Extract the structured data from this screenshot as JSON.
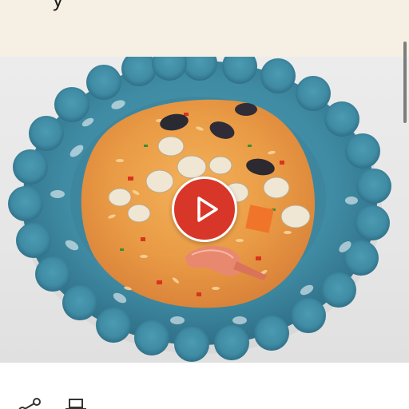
{
  "banner": {
    "text_fragment": "y"
  },
  "video": {
    "play_icon": "play-icon",
    "accent_color": "#d9362a"
  },
  "actions": {
    "share_icon": "share-icon",
    "print_icon": "print-icon"
  }
}
